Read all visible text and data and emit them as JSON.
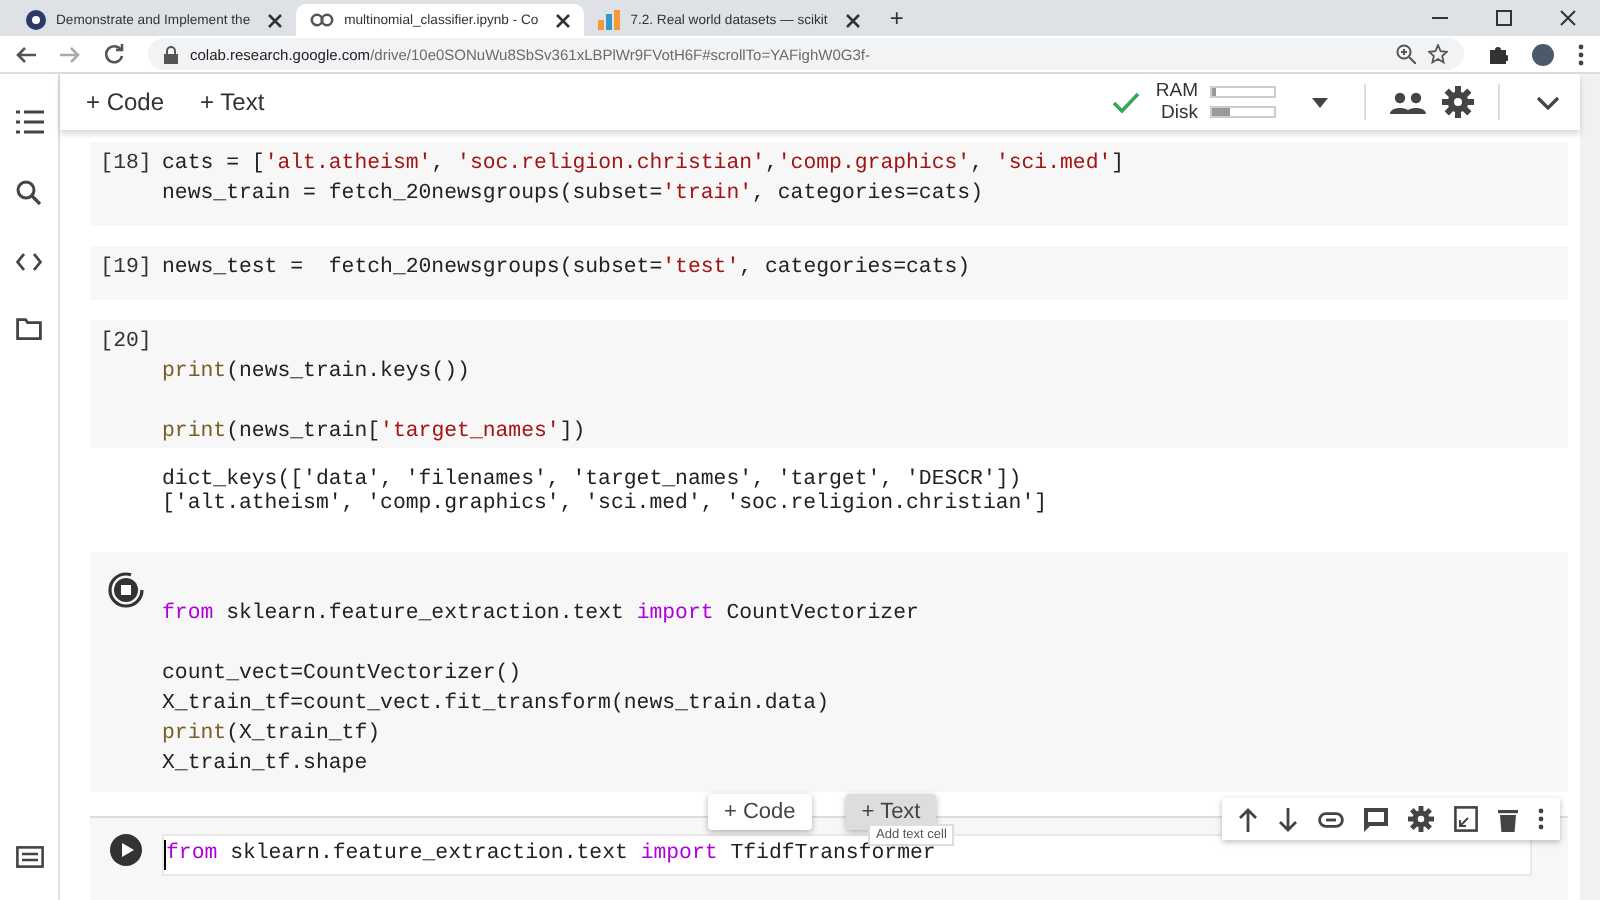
{
  "browser": {
    "tabs": [
      {
        "title": "Demonstrate and Implement the",
        "selected": false
      },
      {
        "title": "multinomial_classifier.ipynb - Co",
        "selected": true
      },
      {
        "title": "7.2. Real world datasets — scikit",
        "selected": false
      }
    ],
    "new_tab": "+",
    "url_host": "colab.research.google.com",
    "url_path": "/drive/10e0SONuWu8SbSv361xLBPlWr9FVotH6F#scrollTo=YAFighW0G3f-"
  },
  "toolbar": {
    "add_code": "+ Code",
    "add_text": "+ Text",
    "ram_label": "RAM",
    "ram": {
      "level": 0.05
    },
    "disk_label": "Disk",
    "disk": {
      "level": 0.3
    }
  },
  "cells": [
    {
      "kind": "done",
      "count": "[18]",
      "lines": [
        [
          {
            "kind": "plain",
            "text": "cats = ["
          },
          {
            "kind": "str",
            "text": "'alt.atheism'"
          },
          {
            "kind": "plain",
            "text": ", "
          },
          {
            "kind": "str",
            "text": "'soc.religion.christian'"
          },
          {
            "kind": "plain",
            "text": ","
          },
          {
            "kind": "str",
            "text": "'comp.graphics'"
          },
          {
            "kind": "plain",
            "text": ", "
          },
          {
            "kind": "str",
            "text": "'sci.med'"
          },
          {
            "kind": "plain",
            "text": "]"
          }
        ],
        [
          {
            "kind": "plain",
            "text": "news_train = fetch_20newsgroups(subset="
          },
          {
            "kind": "str",
            "text": "'train'"
          },
          {
            "kind": "plain",
            "text": ", categories=cats)"
          }
        ]
      ]
    },
    {
      "kind": "done",
      "count": "[19]",
      "lines": [
        [
          {
            "kind": "plain",
            "text": "news_test =  fetch_20newsgroups(subset="
          },
          {
            "kind": "str",
            "text": "'test'"
          },
          {
            "kind": "plain",
            "text": ", categories=cats)"
          }
        ]
      ]
    },
    {
      "kind": "done",
      "count": "[20]",
      "lines": [
        [
          {
            "kind": "fn",
            "text": "print"
          },
          {
            "kind": "plain",
            "text": "(news_train.keys())"
          }
        ],
        [
          {
            "kind": "gap"
          }
        ],
        [
          {
            "kind": "fn",
            "text": "print"
          },
          {
            "kind": "plain",
            "text": "(news_train["
          },
          {
            "kind": "str",
            "text": "'target_names'"
          },
          {
            "kind": "plain",
            "text": "])"
          }
        ]
      ],
      "output": [
        "dict_keys(['data', 'filenames', 'target_names', 'target', 'DESCR'])",
        "['alt.atheism', 'comp.graphics', 'sci.med', 'soc.religion.christian']"
      ]
    },
    {
      "kind": "running",
      "lines": [
        [
          {
            "kind": "kw",
            "text": "from"
          },
          {
            "kind": "plain",
            "text": " sklearn.feature_extraction.text "
          },
          {
            "kind": "kw",
            "text": "import"
          },
          {
            "kind": "plain",
            "text": " CountVectorizer"
          }
        ],
        [
          {
            "kind": "gap"
          }
        ],
        [
          {
            "kind": "plain",
            "text": "count_vect=CountVectorizer()"
          }
        ],
        [
          {
            "kind": "plain",
            "text": "X_train_tf=count_vect.fit_transform(news_train.data)"
          }
        ],
        [
          {
            "kind": "fn",
            "text": "print"
          },
          {
            "kind": "plain",
            "text": "(X_train_tf)"
          }
        ],
        [
          {
            "kind": "plain",
            "text": "X_train_tf.shape"
          }
        ]
      ]
    },
    {
      "kind": "focused",
      "lines": [
        [
          {
            "kind": "kw",
            "text": "from"
          },
          {
            "kind": "plain",
            "text": " sklearn.feature_extraction.text "
          },
          {
            "kind": "kw",
            "text": "import"
          },
          {
            "kind": "plain",
            "text": " TfidfTransformer"
          }
        ]
      ]
    }
  ],
  "insert_bar": {
    "add_code": "+ Code",
    "add_text": "+ Text",
    "tooltip": "Add text cell"
  }
}
